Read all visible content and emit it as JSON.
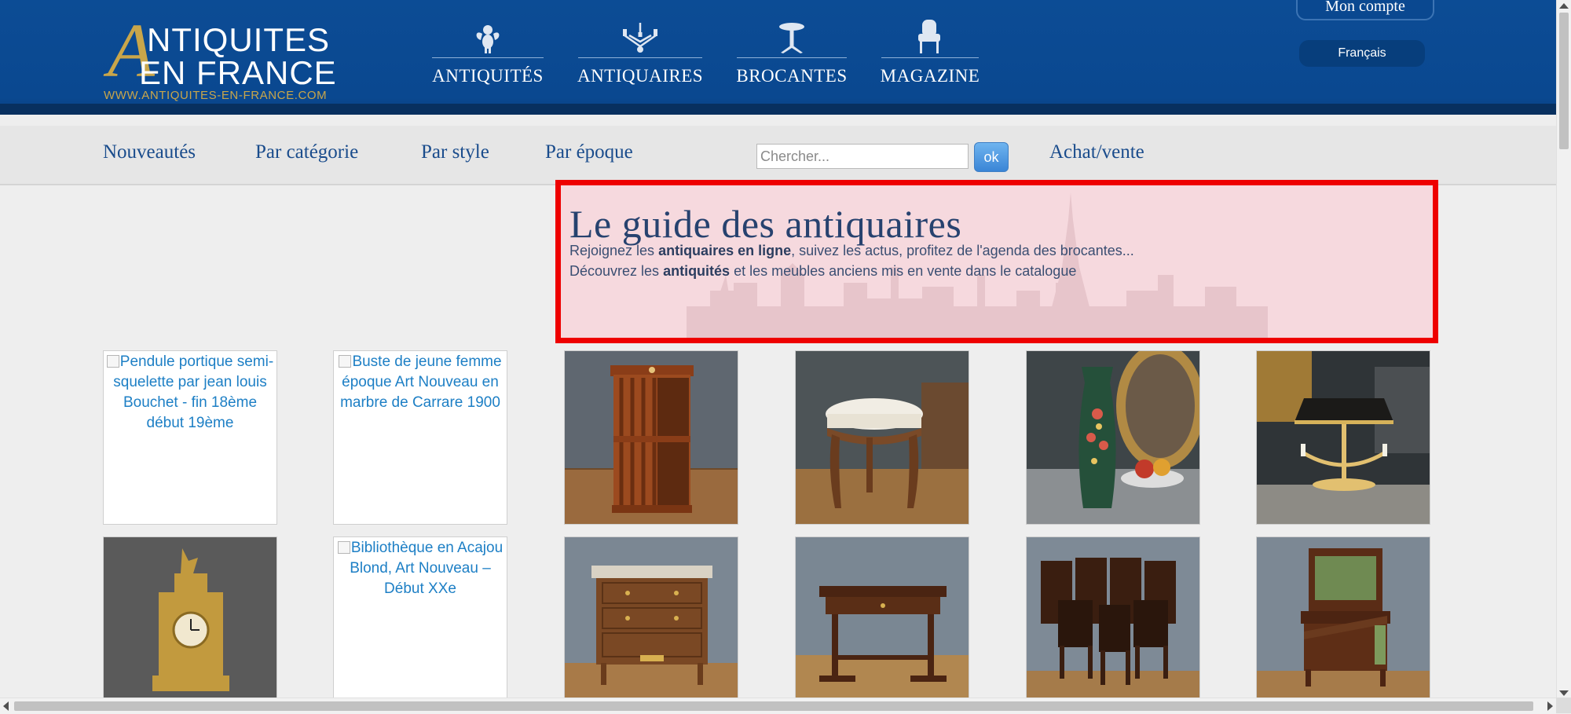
{
  "brand": {
    "line1": "NTIQUITES",
    "line2": "EN FRANCE",
    "initial": "A",
    "url": "WWW.ANTIQUITES-EN-FRANCE.COM"
  },
  "main_nav": [
    {
      "label": "ANTIQUITÉS",
      "icon": "cherub-icon"
    },
    {
      "label": "ANTIQUAIRES",
      "icon": "chandelier-icon"
    },
    {
      "label": "BROCANTES",
      "icon": "pedestal-table-icon"
    },
    {
      "label": "MAGAZINE",
      "icon": "armchair-icon"
    }
  ],
  "account": {
    "label": "Mon compte"
  },
  "language": {
    "selected": "Français"
  },
  "sub_nav": {
    "items": [
      "Nouveautés",
      "Par catégorie",
      "Par style",
      "Par époque"
    ],
    "search_placeholder": "Chercher...",
    "ok_label": "ok",
    "achat_vente": "Achat/vente"
  },
  "hero": {
    "title": "Le guide des antiquaires",
    "line1_pre": "Rejoignez les ",
    "line1_bold": "antiquaires en ligne",
    "line1_post": ", suivez les actus, profitez de l'agenda des brocantes...",
    "line2_pre": "Découvrez les ",
    "line2_bold": "antiquités",
    "line2_post": " et les meubles anciens mis en vente dans le catalogue"
  },
  "products": [
    {
      "alt": "Pendule portique semi-squelette par jean louis Bouchet - fin 18ème début 19ème",
      "broken": true
    },
    {
      "alt": "Buste de jeune femme époque Art Nouveau en marbre de Carrare 1900",
      "broken": true
    },
    {
      "alt": "",
      "broken": false,
      "image": "revolving-bookcase"
    },
    {
      "alt": "",
      "broken": false,
      "image": "upholstered-stool"
    },
    {
      "alt": "",
      "broken": false,
      "image": "painted-vase"
    },
    {
      "alt": "",
      "broken": false,
      "image": "bouillotte-lamp"
    },
    {
      "alt": "",
      "broken": false,
      "image": "gilt-mantel-clock"
    },
    {
      "alt": "Bibliothèque en Acajou Blond, Art Nouveau – Début XXe",
      "broken": true
    },
    {
      "alt": "",
      "broken": false,
      "image": "marble-top-commode"
    },
    {
      "alt": "",
      "broken": false,
      "image": "writing-table"
    },
    {
      "alt": "",
      "broken": false,
      "image": "set-of-chairs"
    },
    {
      "alt": "",
      "broken": false,
      "image": "writing-desk"
    }
  ],
  "colors": {
    "header_blue": "#0c4c95",
    "gold": "#c9a64a",
    "link_blue": "#1a4c8c",
    "highlight_red": "#ee0000"
  }
}
